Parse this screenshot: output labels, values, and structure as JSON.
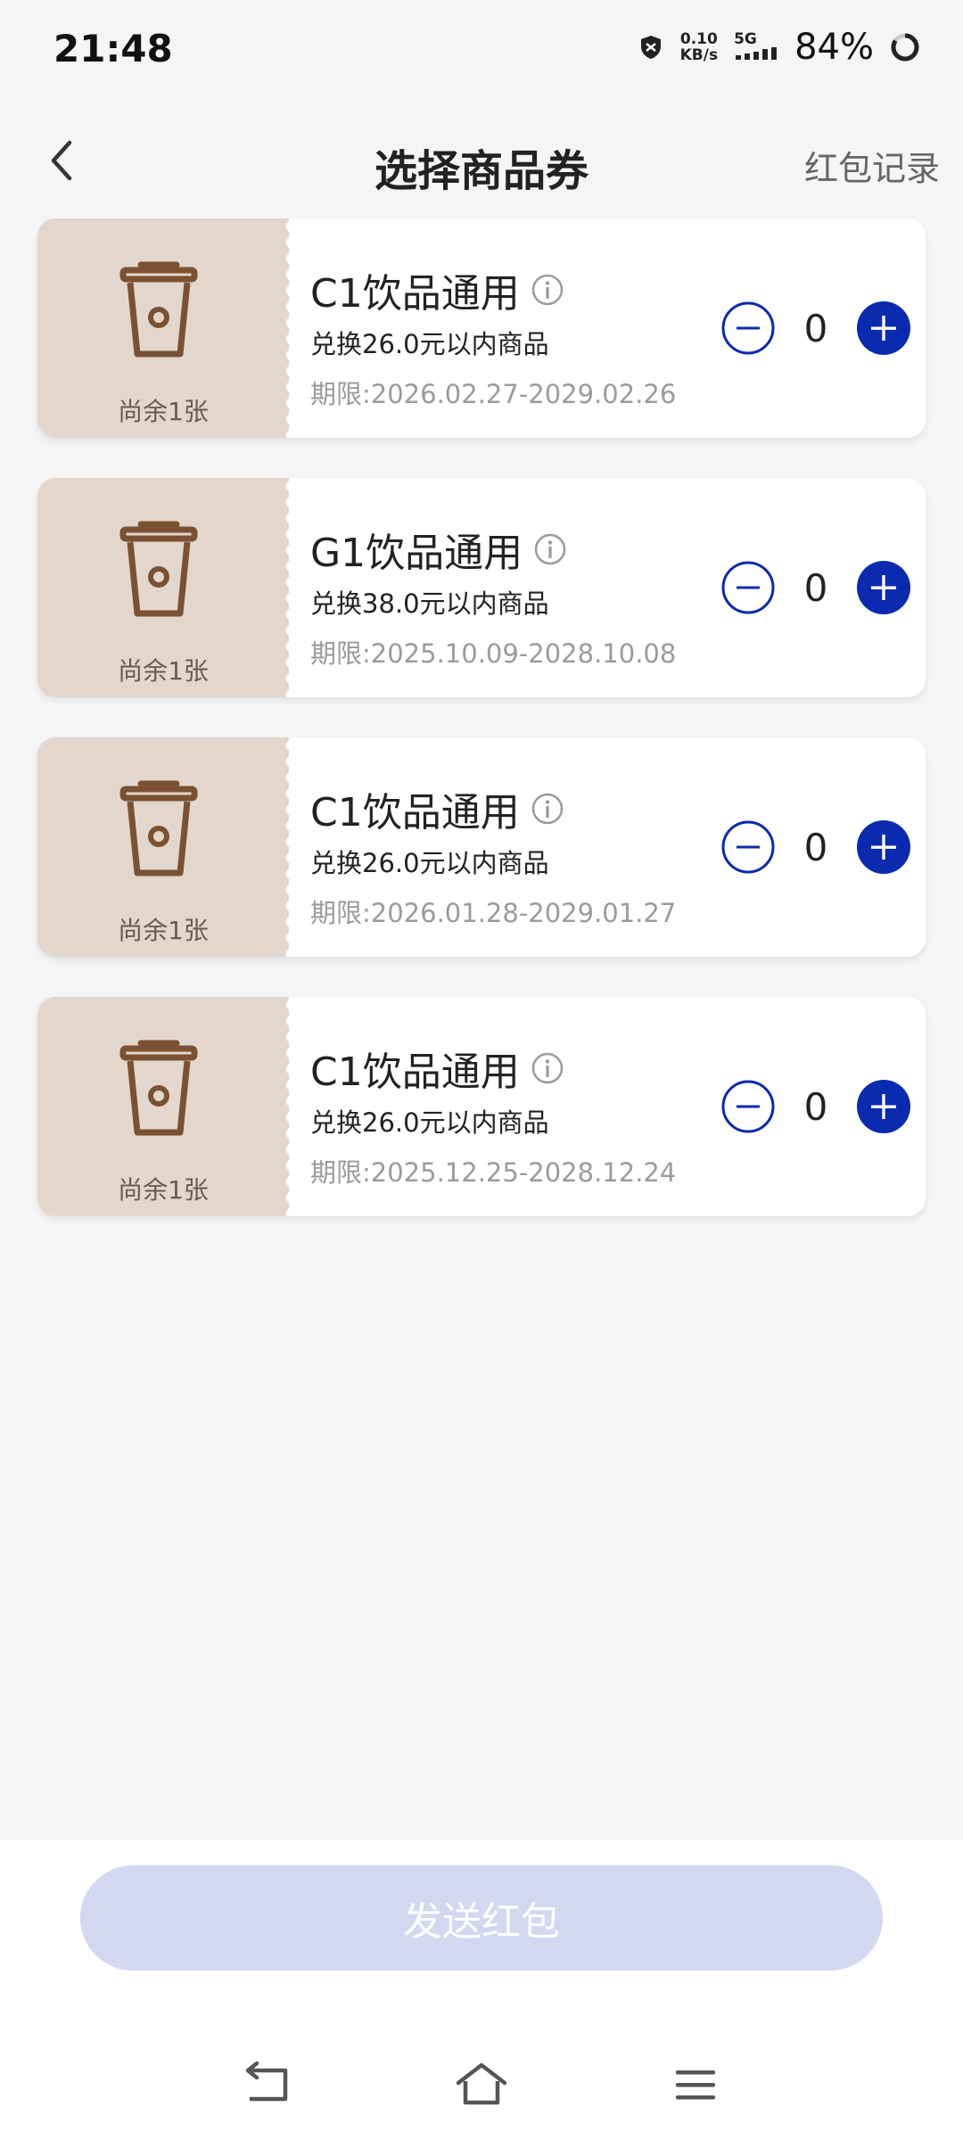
{
  "status": {
    "time": "21:48",
    "net_speed_value": "0.10",
    "net_speed_unit": "KB/s",
    "signal": "5G",
    "battery": "84%"
  },
  "header": {
    "title": "选择商品券",
    "record_link": "红包记录"
  },
  "coupons": [
    {
      "name": "C1饮品通用",
      "desc": "兑换26.0元以内商品",
      "validity": "期限:2026.02.27-2029.02.26",
      "remain": "尚余1张",
      "qty": "0"
    },
    {
      "name": "G1饮品通用",
      "desc": "兑换38.0元以内商品",
      "validity": "期限:2025.10.09-2028.10.08",
      "remain": "尚余1张",
      "qty": "0"
    },
    {
      "name": "C1饮品通用",
      "desc": "兑换26.0元以内商品",
      "validity": "期限:2026.01.28-2029.01.27",
      "remain": "尚余1张",
      "qty": "0"
    },
    {
      "name": "C1饮品通用",
      "desc": "兑换26.0元以内商品",
      "validity": "期限:2025.12.25-2028.12.24",
      "remain": "尚余1张",
      "qty": "0"
    }
  ],
  "footer": {
    "send_button": "发送红包"
  },
  "colors": {
    "accent": "#0a2ab0",
    "stub": "#e3d7cd",
    "cup": "#7a5233",
    "send_disabled": "#d4d7f0"
  }
}
